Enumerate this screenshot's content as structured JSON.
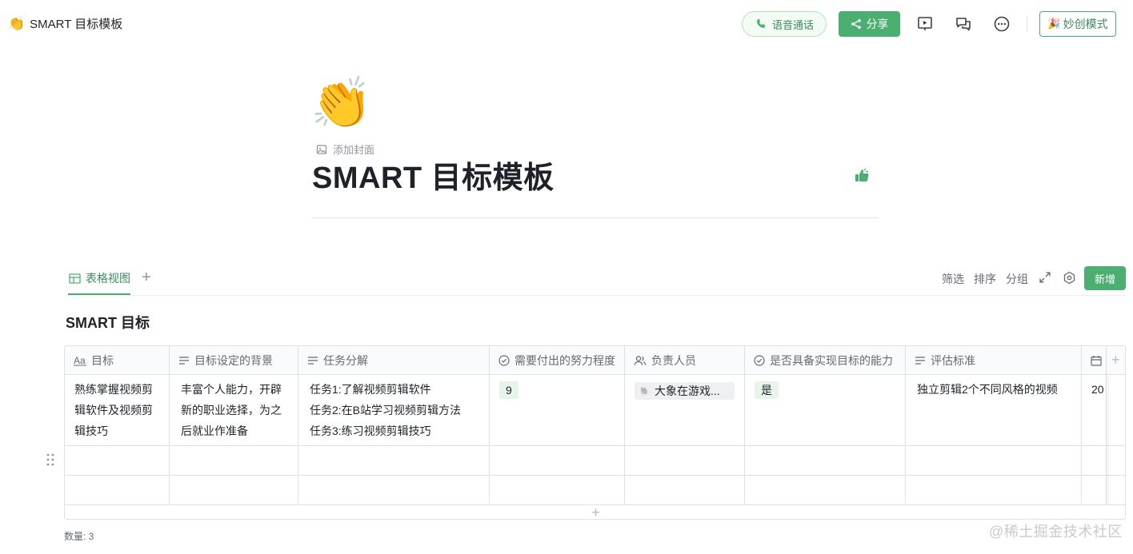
{
  "app": {
    "doc_emoji": "👏",
    "doc_title": "SMART 目标模板"
  },
  "topbar": {
    "voice_call_label": "语音通话",
    "share_label": "分享",
    "create_mode_label": "妙创模式",
    "create_mode_emoji": "🎉",
    "icons": [
      "phone-icon",
      "share-icon",
      "present-icon",
      "comments-icon",
      "more-icon"
    ]
  },
  "header": {
    "emoji": "👏",
    "add_cover_label": "添加封面",
    "page_title": "SMART 目标模板"
  },
  "view_bar": {
    "tab_label": "表格视图",
    "add_view_label": "+",
    "filter_label": "筛选",
    "sort_label": "排序",
    "group_label": "分组",
    "new_label": "新增"
  },
  "table": {
    "title": "SMART 目标",
    "columns": [
      {
        "label": "目标",
        "icon": "text-type-icon"
      },
      {
        "label": "目标设定的背景",
        "icon": "long-text-icon"
      },
      {
        "label": "任务分解",
        "icon": "long-text-icon"
      },
      {
        "label": "需要付出的努力程度",
        "icon": "single-select-icon"
      },
      {
        "label": "负责人员",
        "icon": "people-icon"
      },
      {
        "label": "是否具备实现目标的能力",
        "icon": "single-select-icon"
      },
      {
        "label": "评估标准",
        "icon": "long-text-icon"
      },
      {
        "label": "",
        "icon": "calendar-icon"
      }
    ],
    "rows": [
      {
        "goal": [
          "熟练掌握视频剪",
          "辑软件及视频剪",
          "辑技巧"
        ],
        "background": [
          "丰富个人能力，开辟",
          "新的职业选择，为之",
          "后就业作准备"
        ],
        "tasks": [
          "任务1:了解视频剪辑软件",
          "任务2:在B站学习视频剪辑方法",
          "任务3:练习视频剪辑技巧"
        ],
        "effort": "9",
        "owner": "大象在游戏...",
        "capable": "是",
        "criteria": "独立剪辑2个不同风格的视频",
        "date": "20"
      }
    ],
    "add_row_label": "+",
    "count_label": "数量: 3"
  },
  "watermark": "@稀土掘金技术社区"
}
